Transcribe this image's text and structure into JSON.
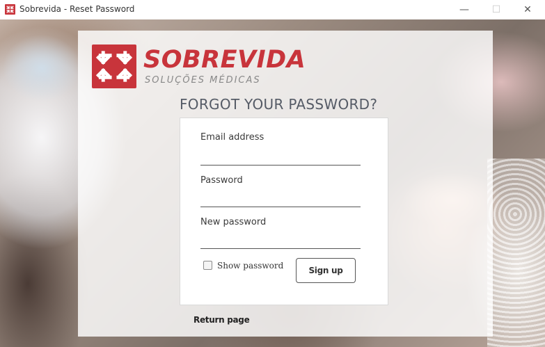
{
  "window": {
    "title": "Sobrevida - Reset Password",
    "minimize_glyph": "—",
    "maximize_glyph": "☐",
    "close_glyph": "✕"
  },
  "brand": {
    "name": "SOBREVIDA",
    "tagline": "SOLUÇÕES MÉDICAS",
    "color": "#c8343b",
    "logo_icon": "arrows-converging-icon"
  },
  "form": {
    "heading": "FORGOT YOUR PASSWORD?",
    "email_label": "Email address",
    "email_value": "",
    "password_label": "Password",
    "password_value": "",
    "new_password_label": "New password",
    "new_password_value": "",
    "show_password_label": "Show password",
    "show_password_checked": false,
    "submit_label": "Sign up"
  },
  "footer": {
    "return_label": "Return page"
  }
}
